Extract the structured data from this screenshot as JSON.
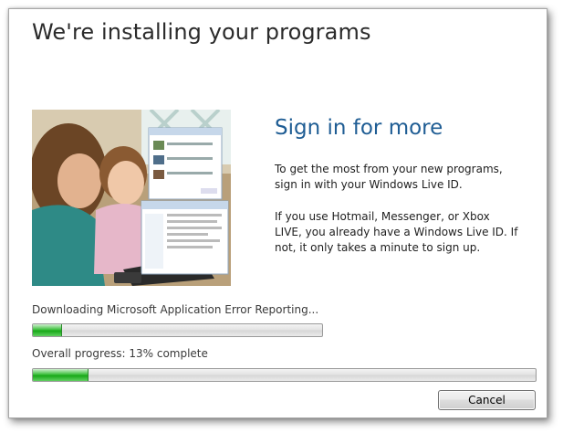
{
  "window": {
    "title": "We're installing your programs"
  },
  "promo": {
    "heading": "Sign in for more",
    "paragraph_1": "To get the most from your new programs, sign in with your Windows Live ID.",
    "paragraph_2": "If you use Hotmail, Messenger, or Xbox LIVE, you already have a Windows Live ID. If not, it only takes a minute to sign up."
  },
  "progress": {
    "current_item_text": "Downloading Microsoft Application Error Reporting...",
    "current_item_fraction": 0.1,
    "overall_text": "Overall progress: 13% complete",
    "overall_fraction": 0.11
  },
  "buttons": {
    "cancel_label": "Cancel"
  },
  "colors": {
    "accent_heading": "#1f5d94",
    "progress_fill": "#18a818"
  }
}
